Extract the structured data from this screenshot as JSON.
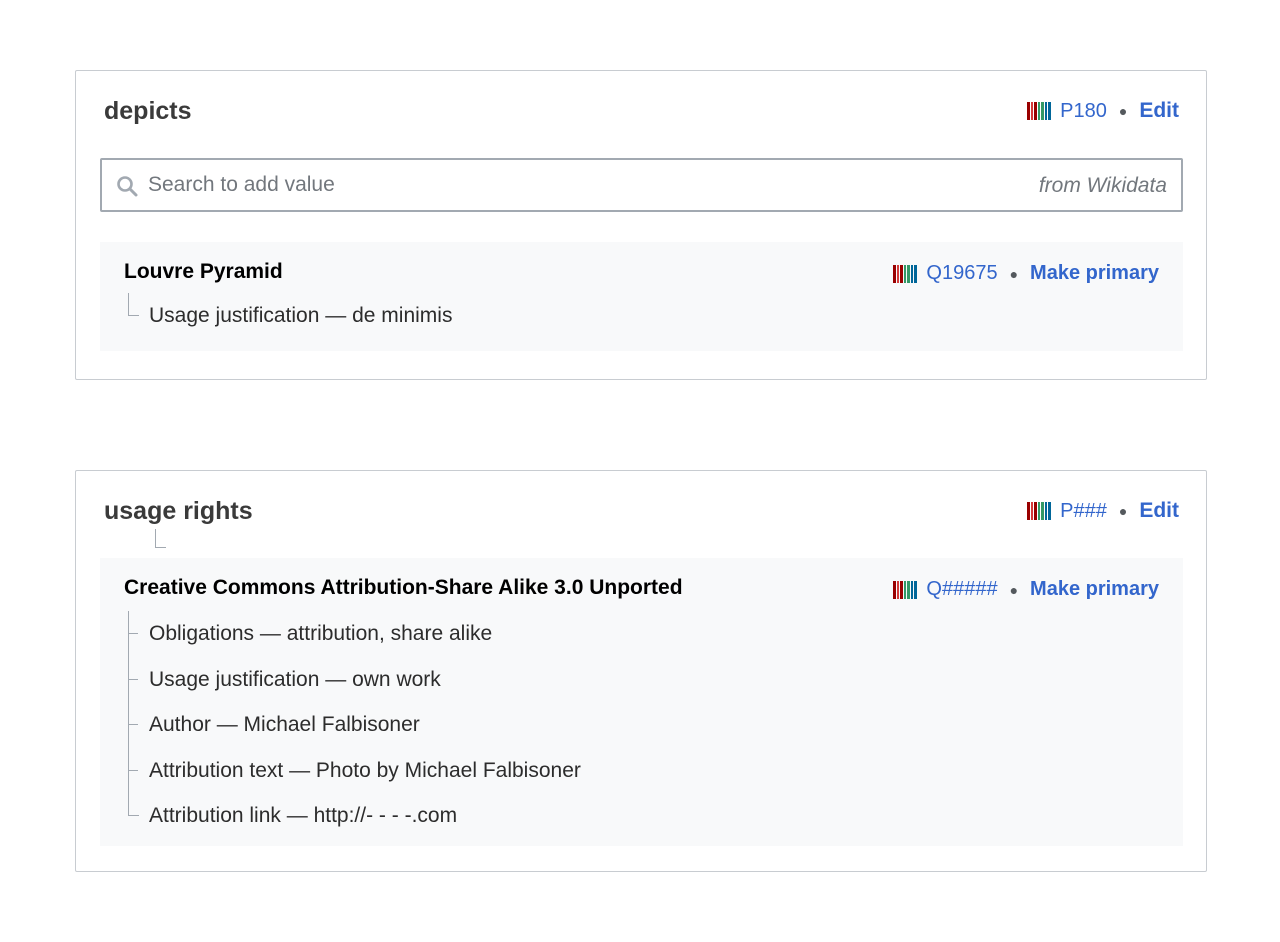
{
  "depicts": {
    "title": "depicts",
    "property_id": "P180",
    "edit_label": "Edit",
    "search": {
      "placeholder": "Search to add value",
      "hint": "from Wikidata"
    },
    "value": {
      "label": "Louvre Pyramid",
      "item_id": "Q19675",
      "action_label": "Make primary",
      "qualifiers": [
        "Usage justification — de minimis"
      ]
    }
  },
  "usage_rights": {
    "title": "usage rights",
    "property_id": "P###",
    "edit_label": "Edit",
    "value": {
      "label": "Creative Commons Attribution-Share Alike 3.0 Unported",
      "item_id": "Q#####",
      "action_label": "Make primary",
      "qualifiers": [
        "Obligations — attribution, share alike",
        "Usage justification — own work",
        "Author — Michael Falbisoner",
        "Attribution text — Photo by Michael Falbisoner",
        "Attribution link — http://- - - -.com"
      ]
    }
  },
  "icons": {
    "wikidata": "wikidata-logo-icon",
    "search": "search-icon"
  },
  "colors": {
    "link": "#3366cc",
    "border": "#c8ccd1",
    "value_bg": "#f8f9fa"
  }
}
